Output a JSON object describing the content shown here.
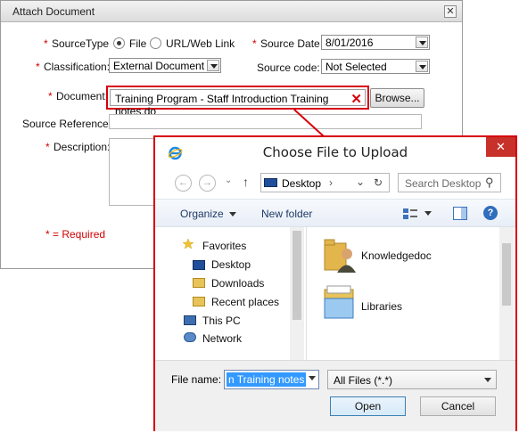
{
  "attach_dialog": {
    "title": "Attach Document",
    "close_glyph": "✕",
    "source_type_label": "SourceType",
    "source_type_options": [
      "File",
      "URL/Web Link"
    ],
    "source_type_selected": "File",
    "source_date_label": "Source Date",
    "source_date_value": "8/01/2016",
    "classification_label": "Classification:",
    "classification_value": "External Document",
    "source_code_label": "Source code:",
    "source_code_value": "Not Selected",
    "document_label": "Document:",
    "document_value": "Training Program - Staff Introduction Training notes.do",
    "clear_glyph": "✕",
    "browse_label": "Browse...",
    "source_reference_label": "Source Reference:",
    "source_reference_value": "",
    "description_label": "Description:",
    "description_value": "",
    "required_marker": "*",
    "required_note": "* = Required",
    "accent_color": "#d6000b"
  },
  "file_dialog": {
    "title": "Choose File to Upload",
    "close_glyph": "✕",
    "back_glyph": "←",
    "forward_glyph": "→",
    "up_glyph": "↑",
    "address_location": "Desktop",
    "address_chevron": "›",
    "dropdown_glyph": "⌄",
    "refresh_glyph": "↻",
    "search_placeholder": "Search Desktop",
    "search_glyph": "⚲",
    "toolbar": {
      "organize_label": "Organize",
      "new_folder_label": "New folder",
      "help_glyph": "?"
    },
    "nav_tree": [
      {
        "label": "Favorites",
        "icon": "star-icon"
      },
      {
        "label": "Desktop",
        "icon": "desktop-icon"
      },
      {
        "label": "Downloads",
        "icon": "downloads-icon"
      },
      {
        "label": "Recent places",
        "icon": "recent-places-icon"
      },
      {
        "label": "This PC",
        "icon": "computer-icon"
      },
      {
        "label": "Network",
        "icon": "network-icon"
      }
    ],
    "items": [
      {
        "label": "Knowledgedoc",
        "icon": "user-folder-icon"
      },
      {
        "label": "Libraries",
        "icon": "libraries-folder-icon"
      }
    ],
    "file_name_label": "File name:",
    "file_name_value": "n Training notes",
    "file_type_value": "All Files (*.*)",
    "open_label": "Open",
    "cancel_label": "Cancel"
  }
}
